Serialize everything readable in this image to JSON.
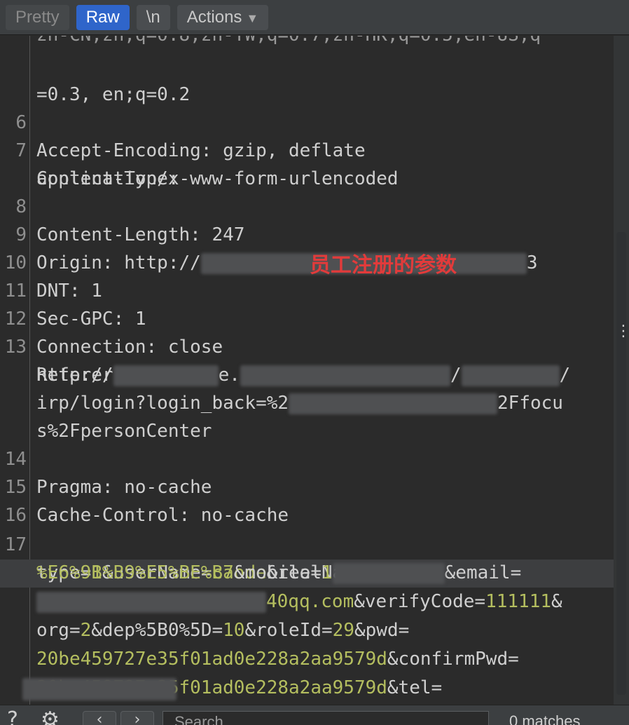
{
  "toolbar": {
    "pretty": "Pretty",
    "raw": "Raw",
    "newline": "\\n",
    "actions": "Actions"
  },
  "annotation": "员工注册的参数",
  "editor": {
    "cut_line": "zh-CN,zh;q=0.8,zh-TW;q=0.7,zh-HK;q=0.5,en-US;q",
    "l5b": "=0.3, en;q=0.2",
    "l6_num": "6",
    "l6": "Accept-Encoding: gzip, deflate",
    "l7_num": "7",
    "l7": "Content-Type:",
    "l7b": "application/x-www-form-urlencoded",
    "l8_num": "8",
    "l8": "Content-Length: 247",
    "l9_num": "9",
    "l9": "Origin: http://",
    "l9_end": "3",
    "l10_num": "10",
    "l10": "DNT: 1",
    "l11_num": "11",
    "l11": "Sec-GPC: 1",
    "l12_num": "12",
    "l12": "Connection: close",
    "l13_num": "13",
    "l13": "Referer:",
    "l13b_a": "http://",
    "l13b_b": "e.",
    "l13b_c": "/",
    "l13b_d": "/",
    "l13c_a": "irp/login?login_back=%2",
    "l13c_b": "2Ffocu",
    "l13d": "s%2FpersonCenter",
    "l14_num": "14",
    "l14": "Pragma: no-cache",
    "l15_num": "15",
    "l15": "Cache-Control: no-cache",
    "l16_num": "16",
    "l17_num": "17",
    "b1_k1": "type=",
    "b1_v1": "1",
    "b1_k2": "&userName=",
    "b1_v2": "caode",
    "b1_k3": "&realName=",
    "b2_v1": "%E6%9B%B9%E5%BE%B7",
    "b2_k1": "&mobile=",
    "b2_v2": "1",
    "b2_k2": "&email=",
    "b3_v1": "40qq.com",
    "b3_k1": "&verifyCode=",
    "b3_v2": "111111",
    "b3_k2": "&",
    "b4_k1": "org=",
    "b4_v1": "2",
    "b4_k2": "&dep%5B0%5D=",
    "b4_v2": "10",
    "b4_k3": "&roleId=",
    "b4_v3": "29",
    "b4_k4": "&pwd=",
    "b5_v1": "20be459727e35f01ad0e228a2aa9579d",
    "b5_k1": "&confirmPwd=",
    "b6_v1": "20be459727e35f01ad0e228a2aa9579d",
    "b6_k1": "&tel="
  },
  "bottom": {
    "search_placeholder": "Search...",
    "matches": "0 matches"
  }
}
